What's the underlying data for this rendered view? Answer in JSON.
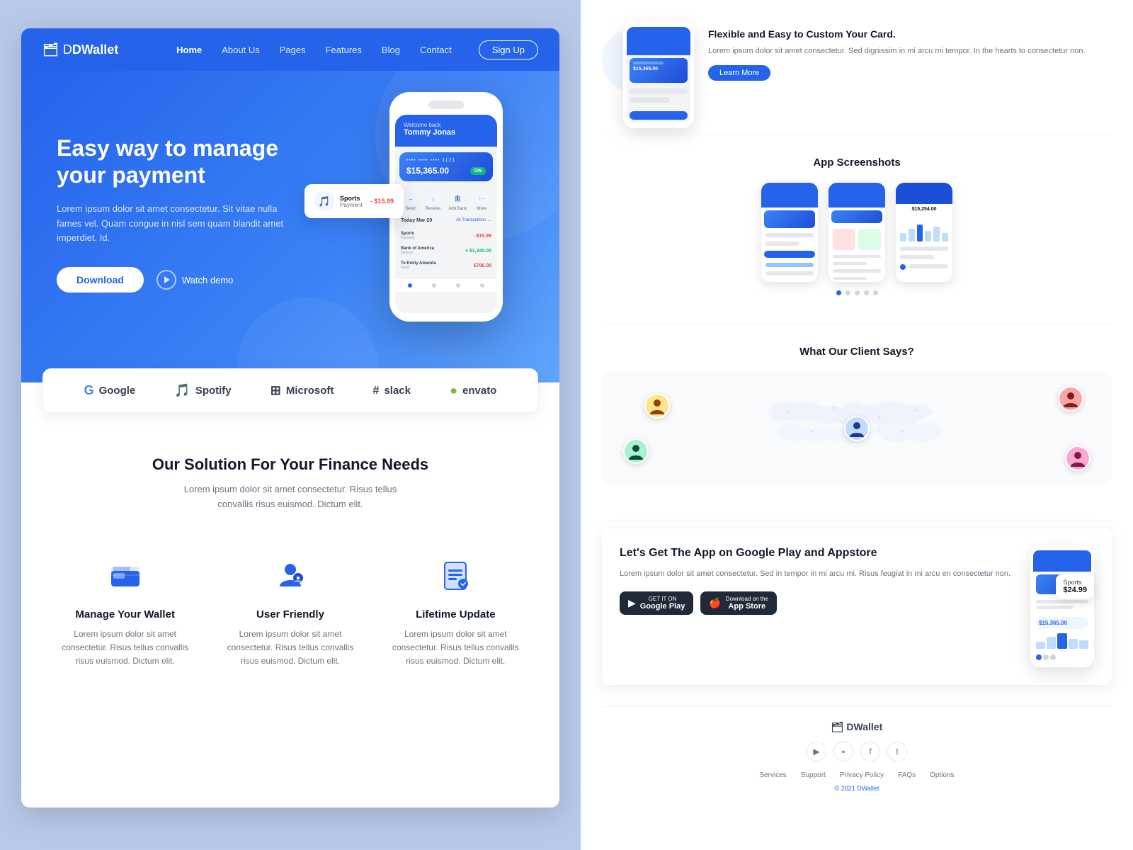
{
  "nav": {
    "logo": "DWallet",
    "logo_icon": "🗂",
    "links": [
      "Home",
      "About Us",
      "Pages",
      "Features",
      "Blog",
      "Contact"
    ],
    "active_link": "Home",
    "signup_label": "Sign Up"
  },
  "hero": {
    "title": "Easy way to manage your payment",
    "description": "Lorem ipsum dolor sit amet consectetur. Sit vitae nulla fames vel. Quam congue in nisl sem quam blandit amet imperdiet. Id.",
    "download_label": "Download",
    "watch_label": "Watch demo"
  },
  "phone_mockup": {
    "welcome": "Welcome back",
    "user_name": "Tommy Jonas",
    "card_number": "•••• •••• •••• 1121",
    "balance": "$15,365.00",
    "toggle": "ON",
    "actions": [
      "Send",
      "Receive",
      "Add Bank",
      "More"
    ],
    "transactions_title": "Today Mar 20",
    "all_transactions": "All Transactions →",
    "transactions": [
      {
        "name": "Sports",
        "sub": "Payment",
        "amount": "- $15.99",
        "positive": false
      },
      {
        "name": "Bank of America",
        "sub": "Deposit",
        "amount": "+ $1,340.00",
        "positive": true
      },
      {
        "name": "To Emily Amanda",
        "sub": "Send",
        "amount": "$786.00",
        "positive": false
      }
    ]
  },
  "floating_card": {
    "icon": "🎵",
    "title": "Sports",
    "sub": "Payment",
    "amount": "- $15.99"
  },
  "brands": [
    {
      "name": "Google",
      "icon": "G"
    },
    {
      "name": "Spotify",
      "icon": "🎵"
    },
    {
      "name": "Microsoft",
      "icon": "⊞"
    },
    {
      "name": "slack",
      "icon": "#"
    },
    {
      "name": "envato",
      "icon": "●"
    }
  ],
  "solution": {
    "title": "Our Solution For Your Finance Needs",
    "description": "Lorem ipsum dolor sit amet consectetur. Risus tellus convallis risus euismod. Dictum elit.",
    "features": [
      {
        "icon": "🗂",
        "title": "Manage Your Wallet",
        "description": "Lorem ipsum dolor sit amet consectetur. Risus tellus convallis risus euismod. Dictum elit."
      },
      {
        "icon": "👤",
        "title": "User Friendly",
        "description": "Lorem ipsum dolor sit amet consectetur. Risus tellus convallis risus euismod. Dictum elit."
      },
      {
        "icon": "📄",
        "title": "Lifetime Update",
        "description": "Lorem ipsum dolor sit amet consectetur. Risus tellus convallis risus euismod. Dictum elit."
      }
    ]
  },
  "flex_card": {
    "title": "Flexible and Easy to Custom Your Card.",
    "description": "Lorem ipsum dolor sit amet consectetur. Sed dignissim in mi arcu mi tempor. In the hearts to consectetur non.",
    "learn_more": "Learn More"
  },
  "screenshots": {
    "title": "App Screenshots",
    "dots": 5
  },
  "clients": {
    "title": "What Our Client Says?"
  },
  "appstore": {
    "title": "Let's Get The App on Google Play and Appstore",
    "description": "Lorem ipsum dolor sit amet consectetur. Sed in tempor in mi arcu mi. Risus feugiat in mi arcu en consectetur non.",
    "google_play": "Google Play",
    "app_store": "App Store"
  },
  "footer": {
    "logo": "DWallet",
    "social": [
      "▶",
      "▪",
      "f",
      "t"
    ],
    "links": [
      "Services",
      "Support",
      "Privacy Policy",
      "FAQs",
      "Options"
    ],
    "copyright": "© 2021",
    "brand": "DWallet"
  }
}
